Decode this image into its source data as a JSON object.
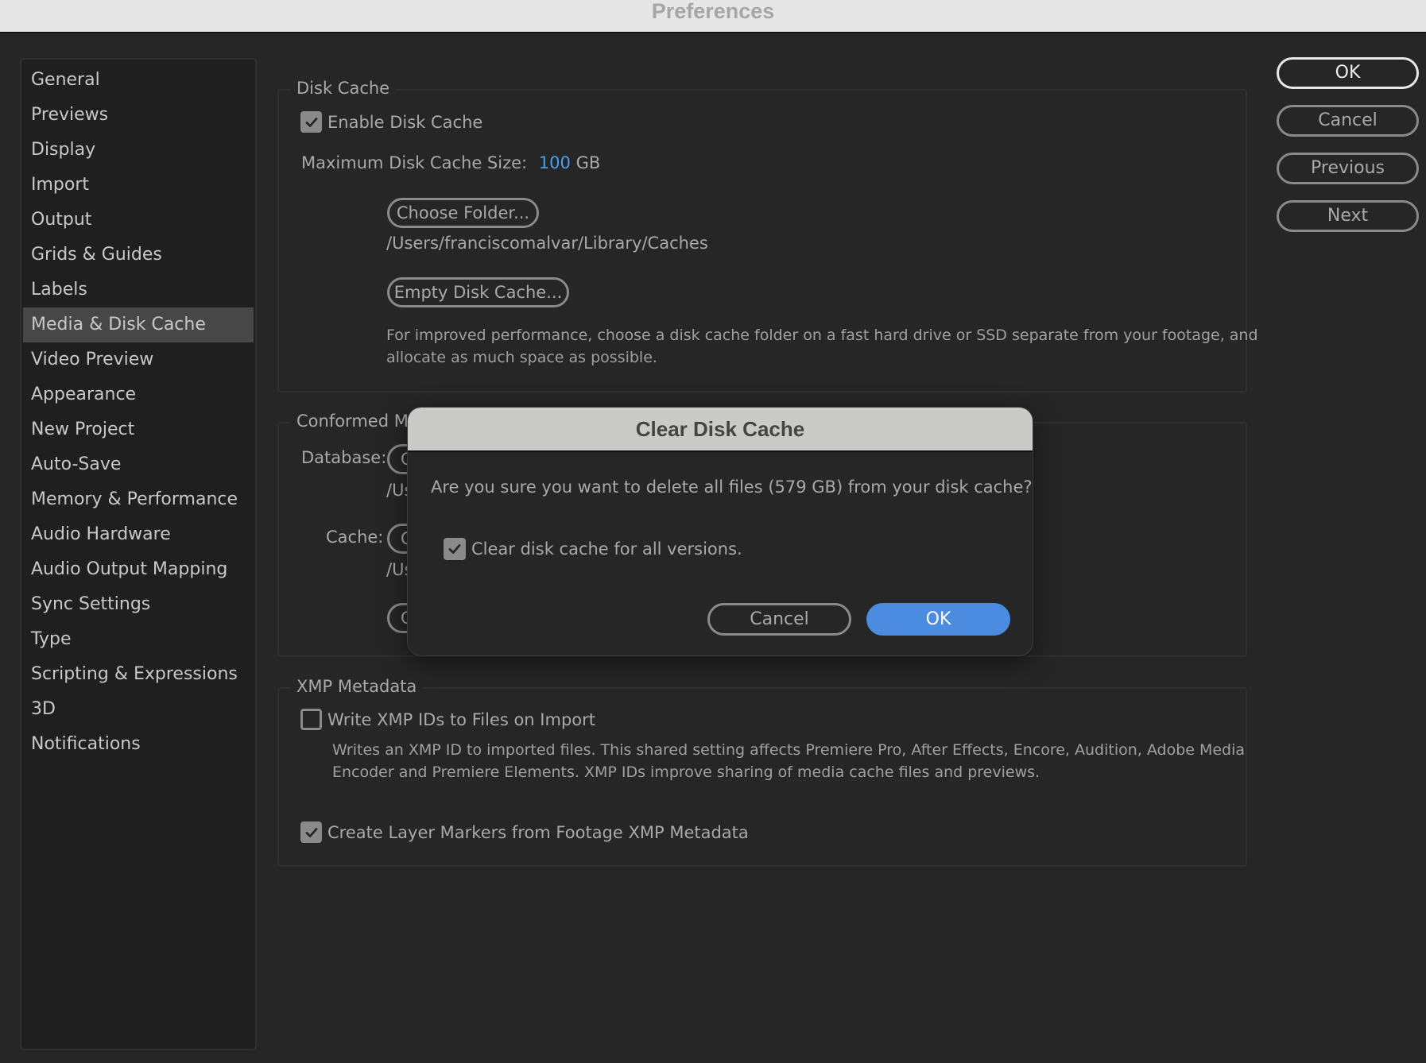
{
  "window": {
    "title": "Preferences"
  },
  "sidebar": {
    "selected_index": 7,
    "items": [
      {
        "label": "General"
      },
      {
        "label": "Previews"
      },
      {
        "label": "Display"
      },
      {
        "label": "Import"
      },
      {
        "label": "Output"
      },
      {
        "label": "Grids & Guides"
      },
      {
        "label": "Labels"
      },
      {
        "label": "Media & Disk Cache"
      },
      {
        "label": "Video Preview"
      },
      {
        "label": "Appearance"
      },
      {
        "label": "New Project"
      },
      {
        "label": "Auto-Save"
      },
      {
        "label": "Memory & Performance"
      },
      {
        "label": "Audio Hardware"
      },
      {
        "label": "Audio Output Mapping"
      },
      {
        "label": "Sync Settings"
      },
      {
        "label": "Type"
      },
      {
        "label": "Scripting & Expressions"
      },
      {
        "label": "3D"
      },
      {
        "label": "Notifications"
      }
    ]
  },
  "disk_cache": {
    "legend": "Disk Cache",
    "enable_label": "Enable Disk Cache",
    "enable_checked": true,
    "max_size_label": "Maximum Disk Cache Size:",
    "max_size_value": "100",
    "max_size_unit": "GB",
    "choose_folder_label": "Choose Folder...",
    "folder_path": "/Users/franciscomalvar/Library/Caches",
    "empty_cache_label": "Empty Disk Cache...",
    "description_line1": "For improved performance, choose a disk cache folder on a fast hard drive or SSD separate from your footage, and",
    "description_line2": "allocate as much space as possible."
  },
  "conformed_media": {
    "legend_visible": "Conformed Me",
    "database_label": "Database:",
    "database_button_visible": "C",
    "database_path_visible": "/Us",
    "cache_label": "Cache:",
    "cache_button_visible": "C",
    "cache_path_visible": "/Us",
    "clean_button_visible": "C"
  },
  "xmp_metadata": {
    "legend": "XMP Metadata",
    "write_ids_label": "Write XMP IDs to Files on Import",
    "write_ids_checked": false,
    "description_line1": "Writes an XMP ID to imported files. This shared setting affects Premiere Pro, After Effects, Encore, Audition, Adobe Media",
    "description_line2": "Encoder and Premiere Elements. XMP IDs improve sharing of media cache files and previews.",
    "layer_markers_label": "Create Layer Markers from Footage XMP Metadata",
    "layer_markers_checked": true
  },
  "actions": {
    "ok_label": "OK",
    "cancel_label": "Cancel",
    "previous_label": "Previous",
    "next_label": "Next"
  },
  "dialog": {
    "title": "Clear Disk Cache",
    "message": "Are you sure you want to delete all files (579 GB) from your disk cache?",
    "checkbox_label": "Clear disk cache for all versions.",
    "checkbox_checked": true,
    "cancel_label": "Cancel",
    "ok_label": "OK"
  },
  "colors": {
    "accent": "#4c9cf0",
    "primary_button": "#4b8be0",
    "background": "#262626",
    "sidebar_bg": "#1f1f1f",
    "sidebar_selected": "#474747"
  }
}
